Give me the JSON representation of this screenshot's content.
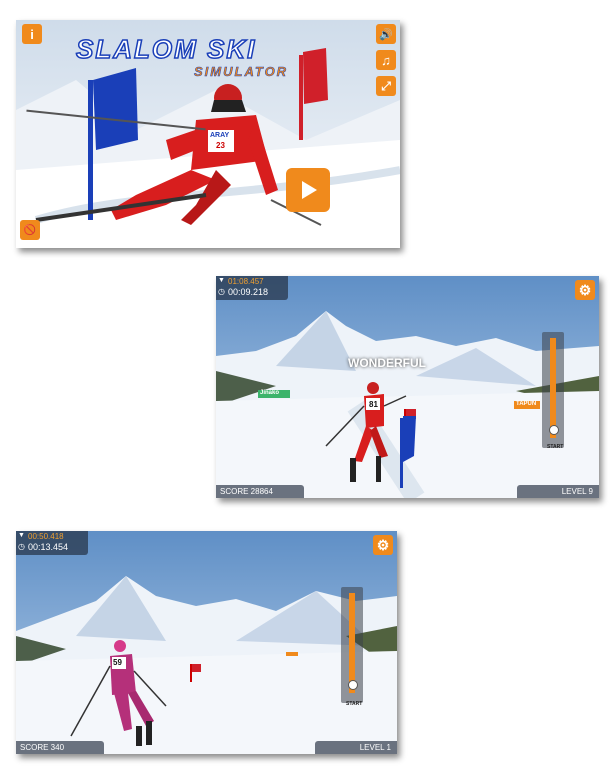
{
  "title_screen": {
    "logo_line1": "SLALOM SKI",
    "logo_line2": "SIMULATOR",
    "bib_text": "ARAY",
    "bib_number": "23",
    "icons": [
      "info-icon",
      "sound-icon",
      "music-icon",
      "fullscreen-icon",
      "play-icon",
      "no-ads-icon"
    ]
  },
  "screens": [
    {
      "best_time": "01:08.457",
      "current_time": "00:09.218",
      "score": "SCORE 28864",
      "level": "LEVEL 9",
      "message": "WONDERFUL",
      "banner_left": "Jinako",
      "banner_right": "TAPUN",
      "start_label": "START",
      "bib_number": "81",
      "progress": 0.05
    },
    {
      "best_time": "00:50.418",
      "current_time": "00:13.454",
      "score": "SCORE 340",
      "level": "LEVEL 1",
      "start_label": "START",
      "bib_number": "59",
      "progress": 0.05
    }
  ],
  "colors": {
    "accent": "#f08a1c",
    "gate_blue": "#1a3fb8",
    "gate_red": "#d0202a",
    "suit_red": "#d81e1e"
  }
}
